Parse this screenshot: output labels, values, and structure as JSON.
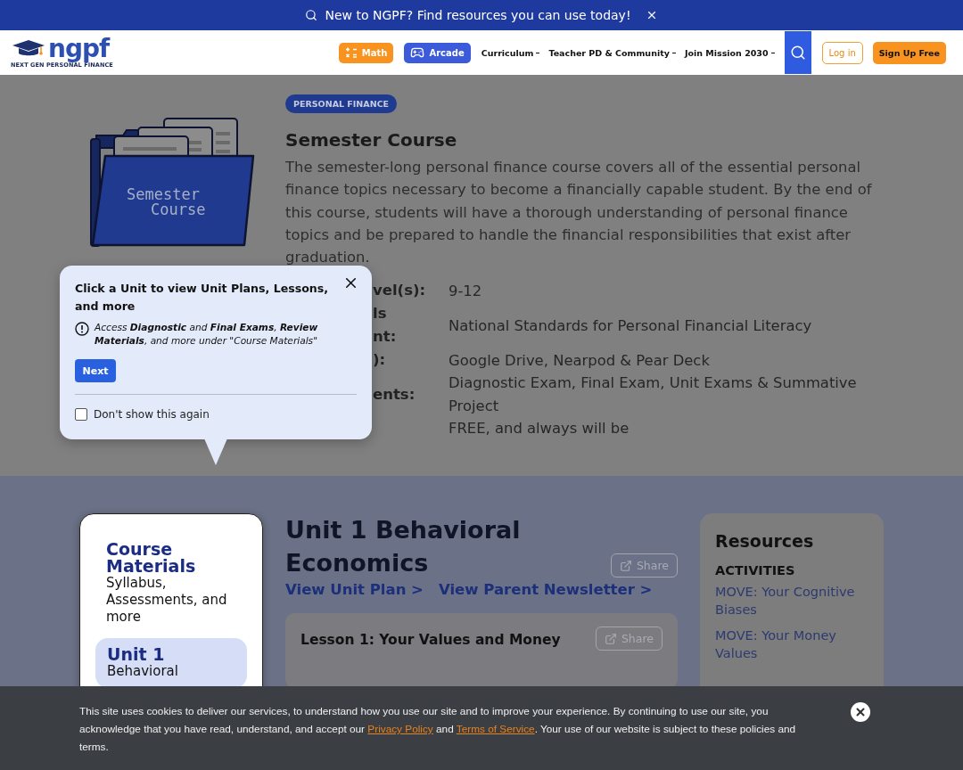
{
  "banner": {
    "text": "New to NGPF? Find resources you can use today!"
  },
  "nav": {
    "logo": {
      "wordmark": "ngpf",
      "tagline": "NEXT GEN PERSONAL FINANCE"
    },
    "buttons": [
      {
        "label": "Math",
        "kind": "math"
      },
      {
        "label": "Arcade",
        "kind": "arcade"
      }
    ],
    "menus": [
      "Curriculum",
      "Teacher PD & Community",
      "Join Mission 2030"
    ],
    "login": "Log in",
    "signup": "Sign Up Free"
  },
  "course": {
    "badge": "PERSONAL FINANCE",
    "illustration_text": [
      "Semester",
      "Course"
    ],
    "title": "Semester Course",
    "description": "The semester-long personal finance course covers all of the essential personal finance topics necessary to become a financially capable student. By the end of this course, students will have a thorough understanding of personal finance topics and be prepared to handle the financial responsibilities that exist after graduation.",
    "details": [
      {
        "label": [
          "vel(s):"
        ],
        "value": "9-12"
      },
      {
        "label": [
          "ls",
          "nt:"
        ],
        "value": "National Standards for Personal Financial Literacy"
      },
      {
        "label": [
          "):"
        ],
        "value": "Google Drive, Nearpod & Pear Deck"
      },
      {
        "label": [
          "ents:"
        ],
        "value": "Diagnostic Exam, Final Exam, Unit Exams & Summative Project"
      },
      {
        "value": "FREE, and always will be"
      }
    ]
  },
  "popup": {
    "title": "Click a Unit to view Unit Plans, Lessons, and more",
    "note": "Access **Diagnostic** and **Final Exams**, **Review Materials**, and more under \"Course Materials\"",
    "button": "Next",
    "checkbox": {
      "label": "Don't show this again",
      "checked": false
    }
  },
  "sidebar": {
    "items": [
      {
        "title": "Course Materials",
        "subtitle": "Syllabus, Assessments, and more",
        "selected": false
      },
      {
        "title": "Unit 1",
        "subtitle": "Behavioral",
        "selected": true
      }
    ]
  },
  "unit": {
    "title": "Unit 1 Behavioral Economics",
    "share": "Share",
    "links": [
      "View Unit Plan >",
      "View Parent Newsletter >"
    ],
    "lessons": [
      {
        "title": "Lesson 1: Your Values and Money",
        "share": "Share"
      }
    ]
  },
  "resources": {
    "title": "Resources",
    "sections": [
      {
        "heading": "ACTIVITIES",
        "items": [
          "MOVE: Your Cognitive Biases",
          "MOVE: Your Money Values"
        ]
      }
    ]
  },
  "cookie": {
    "parts": [
      {
        "kind": "text",
        "text": "This site uses cookies to deliver our services, to understand how you use our site and to improve your experience. By continuing to use our site, you acknowledge that you have read, understand, and accept our "
      },
      {
        "kind": "link",
        "text": "Privacy Policy"
      },
      {
        "kind": "text",
        "text": " and "
      },
      {
        "kind": "link",
        "text": "Terms of Service"
      },
      {
        "kind": "text",
        "text": ". Your use of our website is subject to these policies and terms."
      }
    ]
  }
}
